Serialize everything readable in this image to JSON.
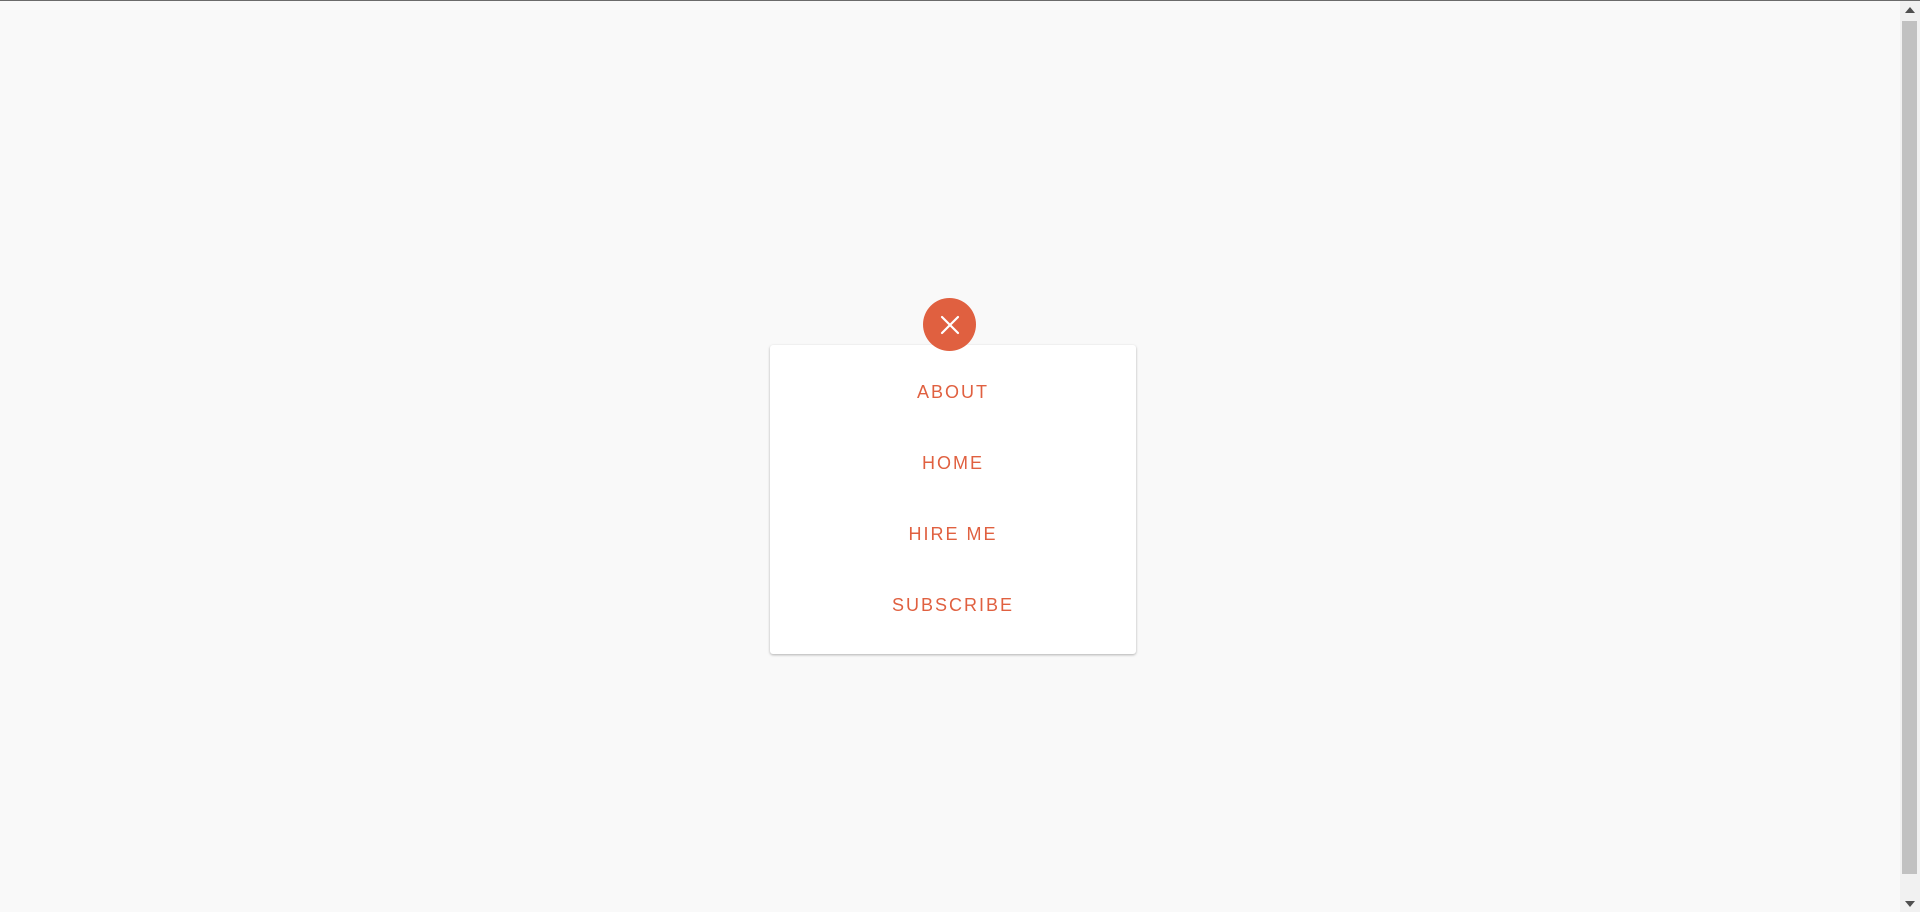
{
  "close_button": {
    "icon": "close-icon",
    "color": "#e06040"
  },
  "menu": {
    "items": [
      {
        "label": "ABOUT"
      },
      {
        "label": "HOME"
      },
      {
        "label": "HIRE ME"
      },
      {
        "label": "SUBSCRIBE"
      }
    ],
    "accent_color": "#e06040"
  },
  "scrollbar": {
    "up_icon": "scroll-up-arrow-icon",
    "down_icon": "scroll-down-arrow-icon"
  }
}
